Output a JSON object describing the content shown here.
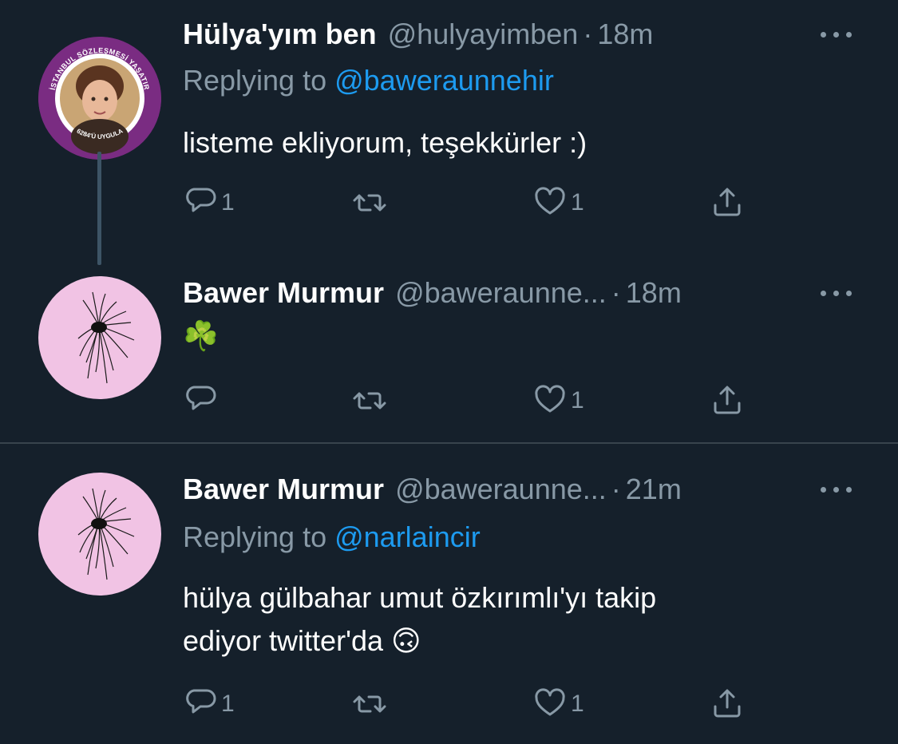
{
  "tweets": [
    {
      "name": "Hülya'yım ben",
      "handle": "@hulyayimben",
      "time": "18m",
      "replying_prefix": "Replying to ",
      "replying_to": "@baweraunnehir",
      "text": "listeme ekliyorum, teşekkürler :)",
      "reply_count": "1",
      "retweet_count": "",
      "like_count": "1",
      "avatar_badge_top": "İSTANBUL SÖZLEŞMESİ YAŞATIR",
      "avatar_badge_bottom": "6284'Ü UYGULA"
    },
    {
      "name": "Bawer Murmur",
      "handle": "@baweraunne...",
      "time": "18m",
      "text": "☘️",
      "reply_count": "",
      "retweet_count": "",
      "like_count": "1"
    },
    {
      "name": "Bawer Murmur",
      "handle": "@baweraunne...",
      "time": "21m",
      "replying_prefix": "Replying to ",
      "replying_to": "@narlaincir",
      "text_line1": "hülya gülbahar umut özkırımlı'yı takip",
      "text_line2": "ediyor twitter'da 🙃",
      "reply_count": "1",
      "retweet_count": "",
      "like_count": "1"
    }
  ],
  "icons": [
    "reply-icon",
    "retweet-icon",
    "like-icon",
    "share-icon",
    "more-icon"
  ],
  "colors": {
    "background": "#15202b",
    "secondary": "#8899a6",
    "link": "#1d9bf0",
    "divider": "#38444d"
  }
}
